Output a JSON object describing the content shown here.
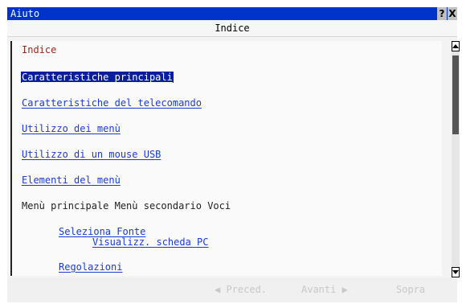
{
  "window": {
    "title": "Aiuto",
    "help_button": "?",
    "close_button": "X"
  },
  "header": {
    "title": "Indice"
  },
  "content": {
    "heading": "Indice",
    "links": [
      "Caratteristiche principali",
      "Caratteristiche del telecomando",
      "Utilizzo dei menù",
      "Utilizzo di un mouse USB",
      "Elementi del menù"
    ],
    "section_text": "Menù principale Menù secondario Voci",
    "sublinks": [
      "Seleziona Fonte",
      "Visualizz. scheda PC",
      "Regolazioni"
    ]
  },
  "footer": {
    "prev": "◀ Preced.",
    "next": "Avanti ▶",
    "top": "Sopra"
  },
  "colors": {
    "titlebar": "#0033cc",
    "link": "#1a3bd8",
    "selected": "#0b1f9e",
    "heading": "#9b2a1f"
  }
}
